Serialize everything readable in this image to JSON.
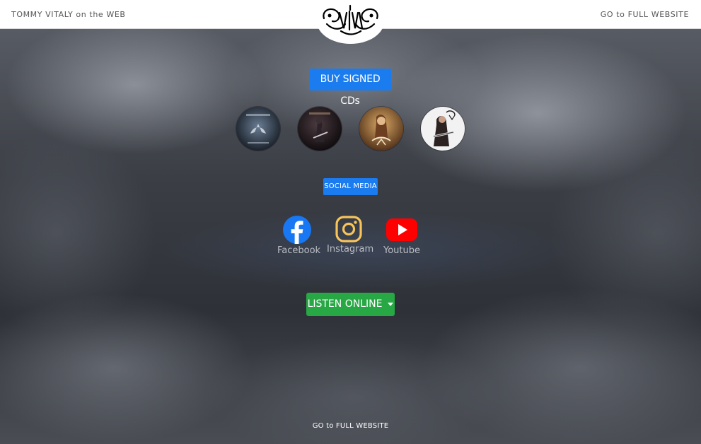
{
  "header": {
    "left_text": "TOMMY VITALY on the WEB",
    "right_link": "GO to FULL WEBSITE",
    "logo": "vitaly-logo"
  },
  "cds": {
    "button_label": "BUY SIGNED CDs",
    "items": [
      {
        "icon": "album-cover-icon",
        "palette": [
          "#1d2734",
          "#5b6d82"
        ]
      },
      {
        "icon": "album-cover-icon",
        "palette": [
          "#140f12",
          "#4a3a3e"
        ]
      },
      {
        "icon": "album-cover-icon",
        "palette": [
          "#5a3418",
          "#c7934f"
        ]
      },
      {
        "icon": "album-cover-icon",
        "palette": [
          "#f0f0f0",
          "#3a2a2a"
        ]
      }
    ]
  },
  "social": {
    "button_label": "SOCIAL MEDIA",
    "items": [
      {
        "label": "Facebook",
        "icon": "facebook-icon",
        "color": "#1877f2"
      },
      {
        "label": "Instagram",
        "icon": "instagram-icon",
        "color": "#f7c45a"
      },
      {
        "label": "Youtube",
        "icon": "youtube-icon",
        "color": "#ff0000"
      }
    ]
  },
  "listen": {
    "button_label": "LISTEN ONLINE",
    "icon": "caret-down-icon"
  },
  "footer": {
    "link": "GO to FULL WEBSITE"
  },
  "colors": {
    "primary_blue": "#1b7cf0",
    "success_green": "#28a745"
  }
}
